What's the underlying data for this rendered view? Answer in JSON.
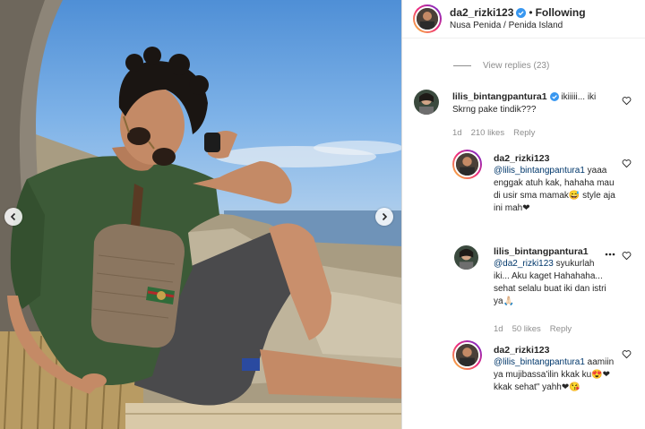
{
  "post": {
    "username": "da2_rizki123",
    "follow_status": "Following",
    "location": "Nusa Penida / Penida Island"
  },
  "thread": {
    "view_replies": "View replies (23)"
  },
  "comments": [
    {
      "username": "lilis_bintangpantura1",
      "text": "ikiiiii... iki Skrng pake tindik???",
      "age": "1d",
      "likes": "210 likes",
      "reply_label": "Reply"
    }
  ],
  "replies": [
    {
      "username": "da2_rizki123",
      "mention": "@lilis_bintangpantura1",
      "text": "yaaa enggak atuh kak, hahaha mau di usir sma mamak😅 style aja ini mah❤"
    },
    {
      "username": "lilis_bintangpantura1",
      "mention": "@da2_rizki123",
      "text": "syukurlah iki... Aku kaget Hahahaha... sehat selalu buat iki dan istri ya🙏🏻",
      "age": "1d",
      "likes": "50 likes",
      "reply_label": "Reply"
    },
    {
      "username": "da2_rizki123",
      "mention": "@lilis_bintangpantura1",
      "text": "aamiin ya mujibassa'ilin kkak ku😍❤ kkak sehat\" yahh❤😘"
    }
  ],
  "colors": {
    "verified": "#3897f0",
    "mention": "#00376b",
    "muted": "#8e8e8e"
  }
}
